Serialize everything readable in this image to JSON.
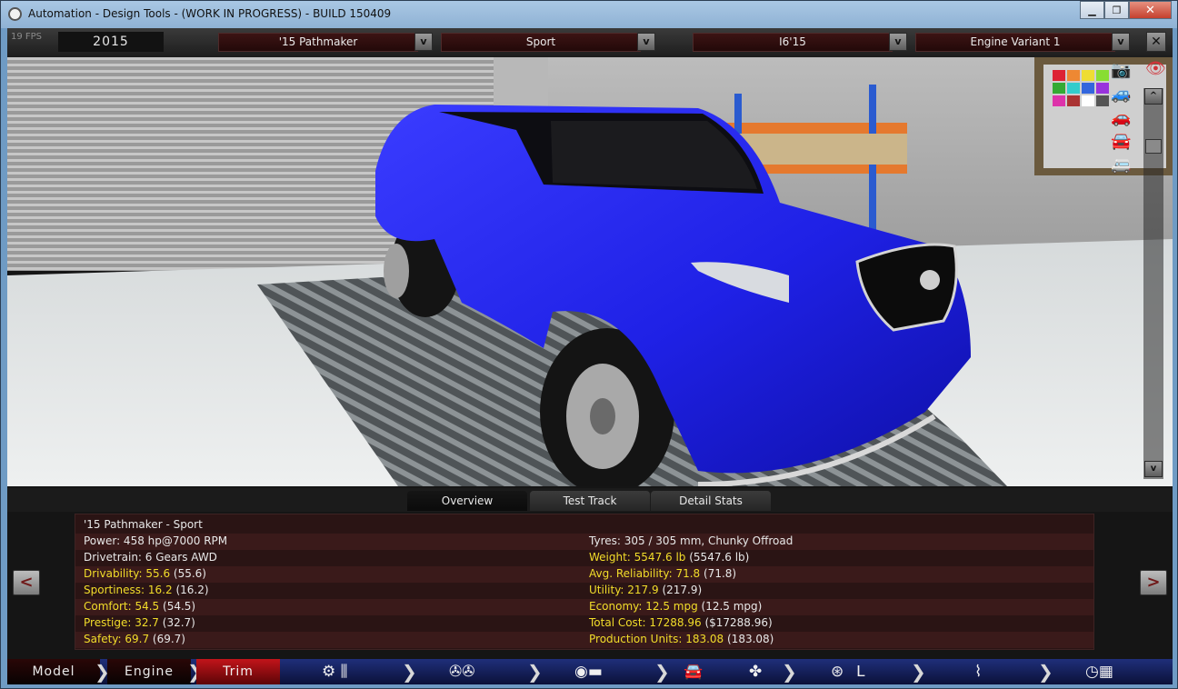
{
  "window": {
    "title": "Automation - Design Tools - (WORK IN PROGRESS) - BUILD 150409",
    "minimize": "▁",
    "restore": "❐",
    "close": "✕"
  },
  "topbar": {
    "fps": "19 FPS",
    "year": "2015",
    "model": "'15 Pathmaker",
    "trim": "Sport",
    "engine": "I6'15",
    "engine_variant": "Engine Variant 1",
    "dropdown_label": "v",
    "close_label": "✕"
  },
  "viewport": {
    "car_color": "#1f21e6",
    "scroll_up": "^",
    "scroll_down": "v"
  },
  "tabs": [
    "Overview",
    "Test Track",
    "Detail Stats"
  ],
  "stats": {
    "title": "'15 Pathmaker - Sport",
    "left": [
      {
        "label": "Power: 458 hp@7000 RPM",
        "value": ""
      },
      {
        "label": "Drivetrain: 6 Gears AWD",
        "value": ""
      },
      {
        "label": "Drivability: 55.6",
        "value": " (55.6)"
      },
      {
        "label": "Sportiness: 16.2",
        "value": " (16.2)"
      },
      {
        "label": "Comfort: 54.5",
        "value": " (54.5)"
      },
      {
        "label": "Prestige: 32.7",
        "value": " (32.7)"
      },
      {
        "label": "Safety: 69.7",
        "value": " (69.7)"
      }
    ],
    "right": [
      {
        "label": "Tyres: 305 / 305 mm, Chunky Offroad",
        "value": ""
      },
      {
        "label": "Weight: 5547.6 lb",
        "value": " (5547.6 lb)"
      },
      {
        "label": "Avg. Reliability: 71.8",
        "value": " (71.8)"
      },
      {
        "label": "Utility: 217.9",
        "value": " (217.9)"
      },
      {
        "label": "Economy: 12.5 mpg",
        "value": " (12.5 mpg)"
      },
      {
        "label": "Total Cost: 17288.96",
        "value": " ($17288.96)"
      },
      {
        "label": "Production Units: 183.08",
        "value": " (183.08)"
      }
    ],
    "prev": "<",
    "next": ">"
  },
  "bottomnav": {
    "model": "Model",
    "engine": "Engine",
    "trim": "Trim",
    "icons": [
      "gearbox-icon",
      "wheels-icon",
      "brakes-icon",
      "car-body-icon",
      "fan-icon",
      "steering-icon",
      "seat-icon",
      "suspension-icon",
      "finish-flag-icon"
    ]
  }
}
